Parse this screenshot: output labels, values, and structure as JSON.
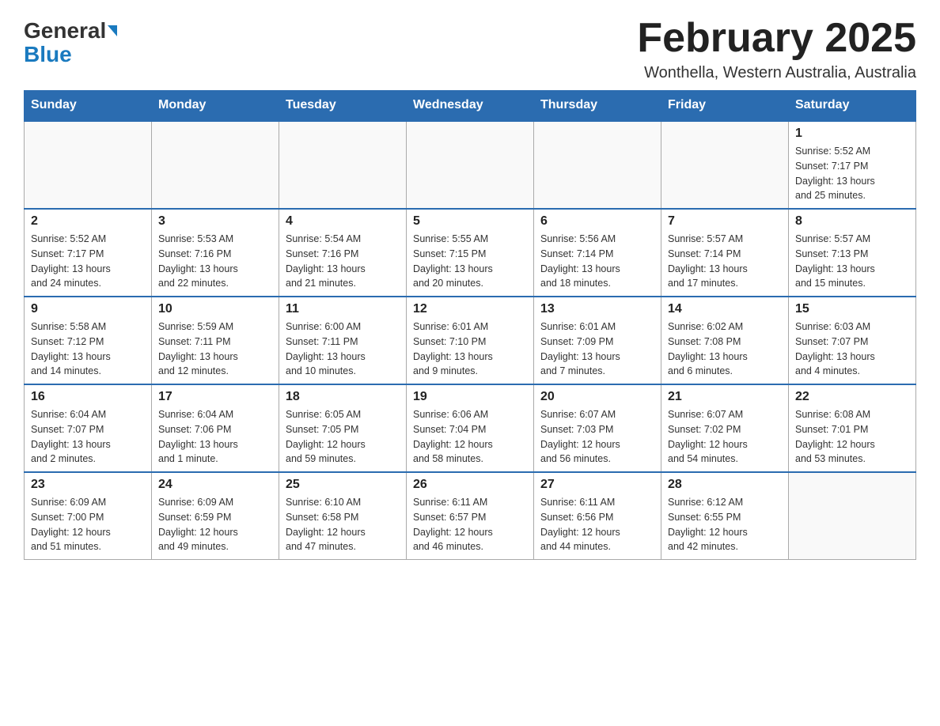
{
  "header": {
    "logo_text1": "General",
    "logo_text2": "Blue",
    "month_title": "February 2025",
    "location": "Wonthella, Western Australia, Australia"
  },
  "weekdays": [
    "Sunday",
    "Monday",
    "Tuesday",
    "Wednesday",
    "Thursday",
    "Friday",
    "Saturday"
  ],
  "weeks": [
    [
      {
        "day": "",
        "info": ""
      },
      {
        "day": "",
        "info": ""
      },
      {
        "day": "",
        "info": ""
      },
      {
        "day": "",
        "info": ""
      },
      {
        "day": "",
        "info": ""
      },
      {
        "day": "",
        "info": ""
      },
      {
        "day": "1",
        "info": "Sunrise: 5:52 AM\nSunset: 7:17 PM\nDaylight: 13 hours\nand 25 minutes."
      }
    ],
    [
      {
        "day": "2",
        "info": "Sunrise: 5:52 AM\nSunset: 7:17 PM\nDaylight: 13 hours\nand 24 minutes."
      },
      {
        "day": "3",
        "info": "Sunrise: 5:53 AM\nSunset: 7:16 PM\nDaylight: 13 hours\nand 22 minutes."
      },
      {
        "day": "4",
        "info": "Sunrise: 5:54 AM\nSunset: 7:16 PM\nDaylight: 13 hours\nand 21 minutes."
      },
      {
        "day": "5",
        "info": "Sunrise: 5:55 AM\nSunset: 7:15 PM\nDaylight: 13 hours\nand 20 minutes."
      },
      {
        "day": "6",
        "info": "Sunrise: 5:56 AM\nSunset: 7:14 PM\nDaylight: 13 hours\nand 18 minutes."
      },
      {
        "day": "7",
        "info": "Sunrise: 5:57 AM\nSunset: 7:14 PM\nDaylight: 13 hours\nand 17 minutes."
      },
      {
        "day": "8",
        "info": "Sunrise: 5:57 AM\nSunset: 7:13 PM\nDaylight: 13 hours\nand 15 minutes."
      }
    ],
    [
      {
        "day": "9",
        "info": "Sunrise: 5:58 AM\nSunset: 7:12 PM\nDaylight: 13 hours\nand 14 minutes."
      },
      {
        "day": "10",
        "info": "Sunrise: 5:59 AM\nSunset: 7:11 PM\nDaylight: 13 hours\nand 12 minutes."
      },
      {
        "day": "11",
        "info": "Sunrise: 6:00 AM\nSunset: 7:11 PM\nDaylight: 13 hours\nand 10 minutes."
      },
      {
        "day": "12",
        "info": "Sunrise: 6:01 AM\nSunset: 7:10 PM\nDaylight: 13 hours\nand 9 minutes."
      },
      {
        "day": "13",
        "info": "Sunrise: 6:01 AM\nSunset: 7:09 PM\nDaylight: 13 hours\nand 7 minutes."
      },
      {
        "day": "14",
        "info": "Sunrise: 6:02 AM\nSunset: 7:08 PM\nDaylight: 13 hours\nand 6 minutes."
      },
      {
        "day": "15",
        "info": "Sunrise: 6:03 AM\nSunset: 7:07 PM\nDaylight: 13 hours\nand 4 minutes."
      }
    ],
    [
      {
        "day": "16",
        "info": "Sunrise: 6:04 AM\nSunset: 7:07 PM\nDaylight: 13 hours\nand 2 minutes."
      },
      {
        "day": "17",
        "info": "Sunrise: 6:04 AM\nSunset: 7:06 PM\nDaylight: 13 hours\nand 1 minute."
      },
      {
        "day": "18",
        "info": "Sunrise: 6:05 AM\nSunset: 7:05 PM\nDaylight: 12 hours\nand 59 minutes."
      },
      {
        "day": "19",
        "info": "Sunrise: 6:06 AM\nSunset: 7:04 PM\nDaylight: 12 hours\nand 58 minutes."
      },
      {
        "day": "20",
        "info": "Sunrise: 6:07 AM\nSunset: 7:03 PM\nDaylight: 12 hours\nand 56 minutes."
      },
      {
        "day": "21",
        "info": "Sunrise: 6:07 AM\nSunset: 7:02 PM\nDaylight: 12 hours\nand 54 minutes."
      },
      {
        "day": "22",
        "info": "Sunrise: 6:08 AM\nSunset: 7:01 PM\nDaylight: 12 hours\nand 53 minutes."
      }
    ],
    [
      {
        "day": "23",
        "info": "Sunrise: 6:09 AM\nSunset: 7:00 PM\nDaylight: 12 hours\nand 51 minutes."
      },
      {
        "day": "24",
        "info": "Sunrise: 6:09 AM\nSunset: 6:59 PM\nDaylight: 12 hours\nand 49 minutes."
      },
      {
        "day": "25",
        "info": "Sunrise: 6:10 AM\nSunset: 6:58 PM\nDaylight: 12 hours\nand 47 minutes."
      },
      {
        "day": "26",
        "info": "Sunrise: 6:11 AM\nSunset: 6:57 PM\nDaylight: 12 hours\nand 46 minutes."
      },
      {
        "day": "27",
        "info": "Sunrise: 6:11 AM\nSunset: 6:56 PM\nDaylight: 12 hours\nand 44 minutes."
      },
      {
        "day": "28",
        "info": "Sunrise: 6:12 AM\nSunset: 6:55 PM\nDaylight: 12 hours\nand 42 minutes."
      },
      {
        "day": "",
        "info": ""
      }
    ]
  ]
}
